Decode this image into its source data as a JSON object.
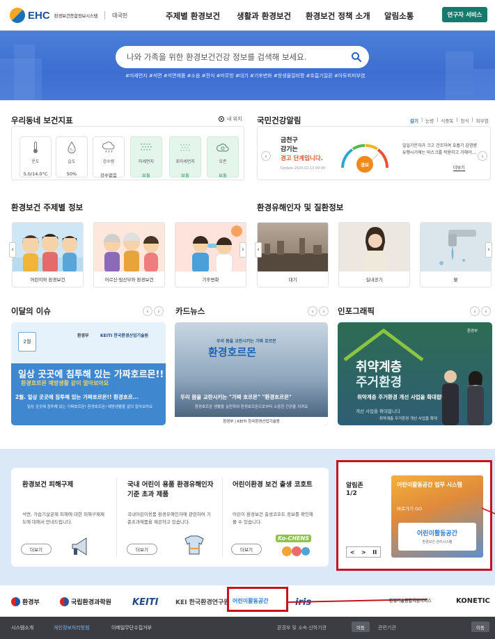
{
  "header": {
    "logo_text": "EHC",
    "logo_sub": "환경보건종합정보시스템",
    "logo_country": "대국민",
    "nav": [
      "주제별 환경보건",
      "생활과 환경보건",
      "환경보건 정책 소개",
      "알림소통"
    ],
    "researcher_btn": "연구자 서비스"
  },
  "hero": {
    "search_placeholder": "나와 가족을 위한 환경보건건강 정보를 검색해 보세요.",
    "tags": "#미세먼지 #석면 #석면제품 #소음 #전식 #미무방 #대기 #기후변화 #항생물질비평 #호흡기질환 #아토피피부염"
  },
  "neighborhood": {
    "title": "우리동네 보건지표",
    "location_label": "내 위치",
    "items": [
      {
        "label": "온도",
        "value": "5.0/14.0°C",
        "icon": "thermometer-icon",
        "status": "normal"
      },
      {
        "label": "습도",
        "value": "50%",
        "icon": "humidity-icon",
        "status": "normal"
      },
      {
        "label": "강수량",
        "value": "강수없음",
        "icon": "rain-cloud-icon",
        "status": "normal"
      },
      {
        "label": "미세먼지",
        "value": "보통",
        "icon": "dust-icon",
        "status": "good"
      },
      {
        "label": "초미세먼지",
        "value": "보통",
        "icon": "fine-dust-icon",
        "status": "good"
      },
      {
        "label": "오존",
        "value": "보통",
        "icon": "ozone-cloud-icon",
        "status": "good"
      }
    ]
  },
  "national_alert": {
    "title": "국민건강알림",
    "tabs": [
      "감기",
      "눈병",
      "식중독",
      "천식",
      "피부염"
    ],
    "region": "금천구",
    "disease": "감기는",
    "status_line": "경고 단계입니다.",
    "update": "Update 2024.02.13 00:00",
    "gauge_label": "경보",
    "advice": "일일기온차가 크고 건조하여 호흡기 감염병 유행시기에는 마스크를 착용하고 거해야...",
    "more": "더보기"
  },
  "topic_info": {
    "title": "환경보건 주제별 정보",
    "cards": [
      "어린이와 환경보건",
      "어르신·임산부와 환경보건",
      "기후변화"
    ]
  },
  "hazard_info": {
    "title": "환경유해인자 및 질환정보",
    "cards": [
      "대기",
      "실내공기",
      "물"
    ]
  },
  "issue": {
    "title": "이달의 이슈",
    "org1": "환경부",
    "org2": "KEITI 한국환경산업기술원",
    "date_tag": "2월",
    "headline": "일상 곳곳에 침투해 있는 가짜호르몬!!",
    "sub_headline": "환경호르몬 예방생활 같이 알아보아요",
    "caption": "2월. 일상 곳곳에 침투해 있는 가짜호르몬!! 환경호르...",
    "desc": "일상 곳곳에 침투해 있는 가짜호르몬! 환경호르몬! 예방생활을 같이 알아보아요"
  },
  "cardnews": {
    "title": "카드뉴스",
    "top_tag": "우리 몸을 교란시키는 가짜 호르몬",
    "big_text": "환경호르몬",
    "caption": "우리 몸을 교란시키는 \"가짜 호르몬\" \"환경호르몬\"",
    "desc": "환경호르몬 생활을 실천하여 환경호르몬으로부터 소중한 건강을 지켜요",
    "footer": "환경부  |  KEITI 한국환경산업기술원"
  },
  "infographic": {
    "title": "인포그래픽",
    "org": "환경부",
    "big1": "취약계층",
    "big2": "주거환경",
    "subtitle": "개선 사업을 확대합니다",
    "caption": "취약계층 주거환경 개선 사업을 확대합니다",
    "desc": "취약계층 주거환경 개선 사업을 확대"
  },
  "bottom_info": [
    {
      "title": "환경보건 피해구제",
      "desc": "석면, 가습기살균제 피해에 대한 피해구제제도에 대해서 안내드립니다.",
      "btn": "더보기"
    },
    {
      "title": "국내 어린이 용품 환경유해인자 기준 초과 제품",
      "desc": "국내어린이용품 환경유해인자에 관련하여 기준초과제품을 제공하고 있습니다.",
      "btn": "더보기"
    },
    {
      "title": "어린이환경 보건 출생 코호트",
      "desc": "어린이 환경보건 출생코호트 정보를 확인해 볼 수 있습니다.",
      "btn": "더보기"
    }
  ],
  "cohort_logo": "Ko-CHENS",
  "alarm_zone": {
    "title": "알림존",
    "page": "1/2",
    "banner_title": "어린이활동공간 업무 시스템",
    "banner_sub": "바로가기 GO",
    "logo_text": "어린이활동공간",
    "logo_sub": "환경보건 관리시스템"
  },
  "partners": [
    "환경부",
    "국립환경과학원",
    "KEITI",
    "KEI 한국환경연구원",
    "어린이활동공간",
    "iris",
    "환경기술종합지원서비스",
    "KONETIC"
  ],
  "footer": {
    "links": [
      "시스템소개",
      "개인정보처리방침",
      "이메일무단수집거부"
    ],
    "select1": "환경부 및 소속·산하기관",
    "btn1": "이동",
    "select2": "관련기관",
    "btn2": "이동"
  },
  "colors": {
    "accent": "#147a6b",
    "hero": "#4274d6",
    "highlight": "#c8101e",
    "good": "#23a05a"
  }
}
